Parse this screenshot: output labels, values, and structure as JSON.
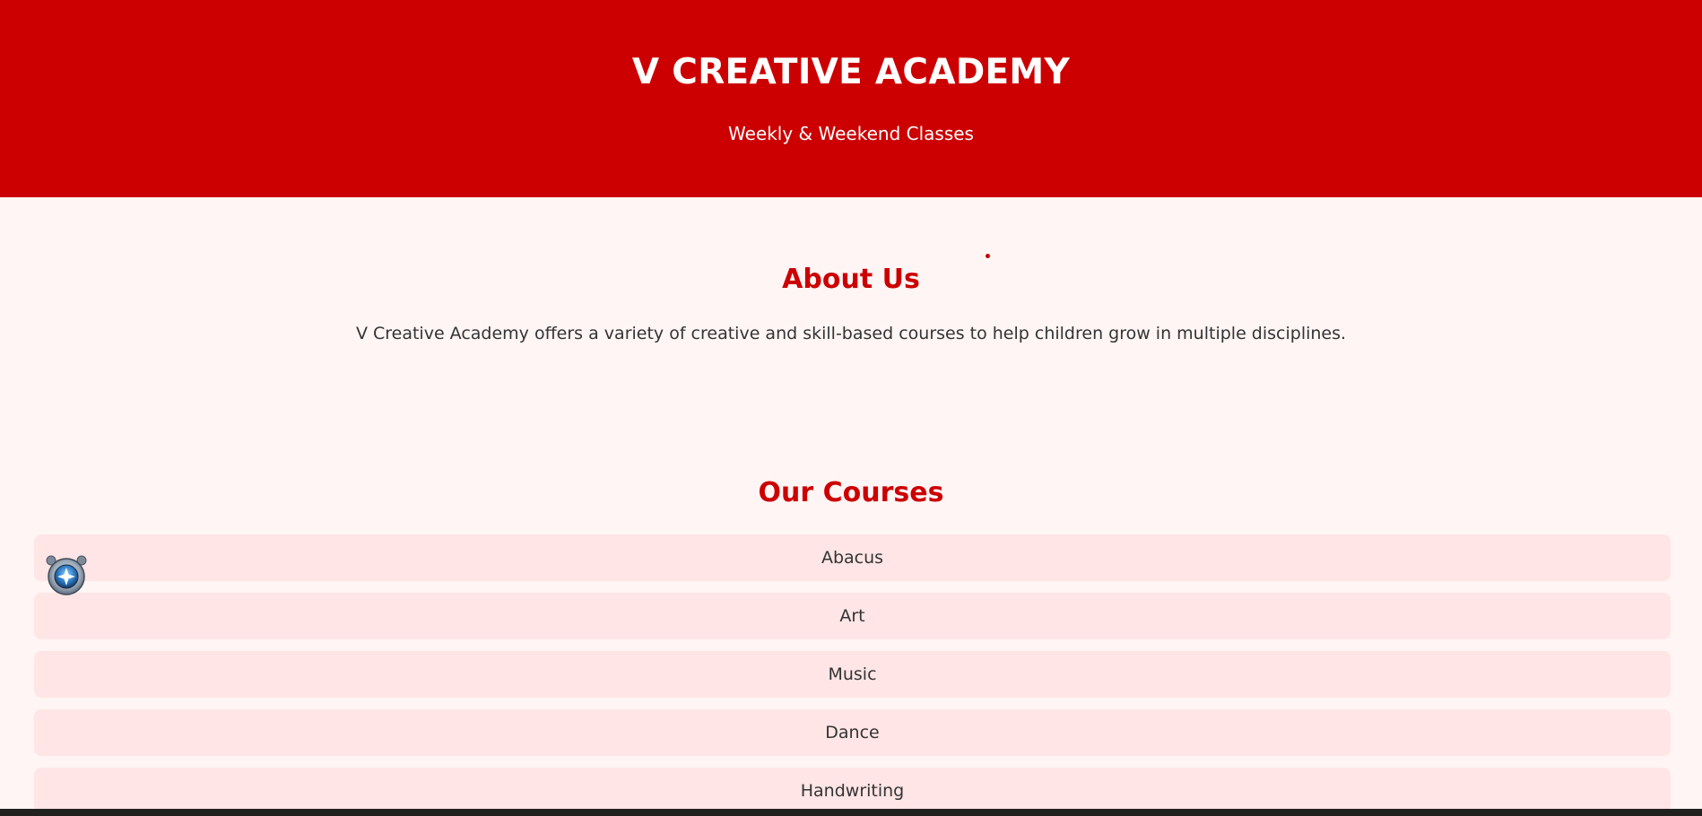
{
  "header": {
    "title": "V CREATIVE ACADEMY",
    "tagline": "Weekly & Weekend Classes"
  },
  "about": {
    "heading": "About Us",
    "text": "V Creative Academy offers a variety of creative and skill-based courses to help children grow in multiple disciplines."
  },
  "courses": {
    "heading": "Our Courses",
    "items": [
      {
        "label": "Abacus"
      },
      {
        "label": "Art"
      },
      {
        "label": "Music"
      },
      {
        "label": "Dance"
      },
      {
        "label": "Handwriting"
      }
    ]
  },
  "widget": {
    "icon": "assistant-bot-icon"
  },
  "colors": {
    "brand_red": "#cc0000",
    "page_bg": "#fff5f5",
    "course_bg": "#ffe5e5",
    "text_dark": "#333333"
  }
}
